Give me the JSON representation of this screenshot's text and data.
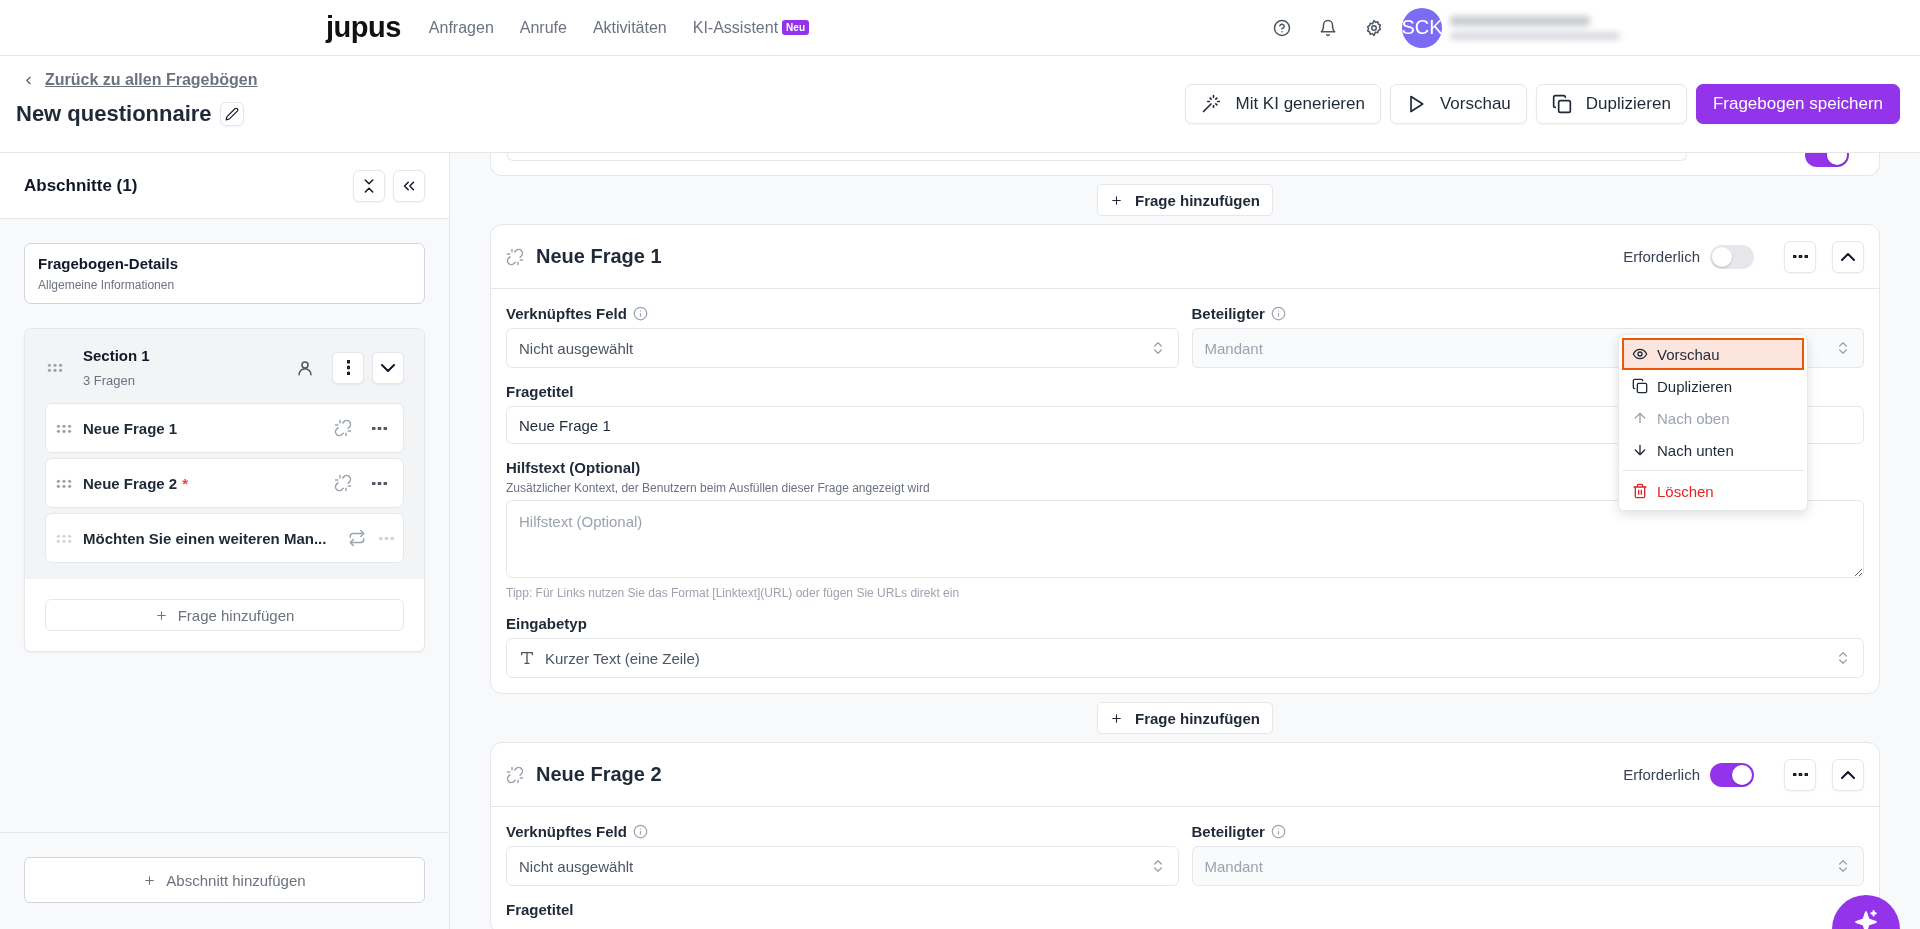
{
  "header": {
    "logo": "jupus",
    "nav": [
      {
        "label": "Anfragen"
      },
      {
        "label": "Anrufe"
      },
      {
        "label": "Aktivitäten"
      },
      {
        "label": "KI-Assistent",
        "badge": "Neu"
      }
    ],
    "avatar": "SCK"
  },
  "page": {
    "back_link": "Zurück zu allen Fragebögen",
    "title": "New questionnaire",
    "actions": [
      {
        "label": "Mit KI generieren",
        "kind": "wand"
      },
      {
        "label": "Vorschau",
        "kind": "play"
      },
      {
        "label": "Duplizieren",
        "kind": "copy"
      },
      {
        "label": "Fragebogen speichern",
        "kind": "primary"
      }
    ]
  },
  "sidebar": {
    "title": "Abschnitte (1)",
    "required_mark": "*",
    "details": {
      "title": "Fragebogen-Details",
      "subtitle": "Allgemeine Informationen"
    },
    "sections": [
      {
        "title": "Section 1",
        "count": "3 Fragen",
        "add_button": "Frage hinzufügen",
        "items": [
          {
            "label": "Neue Frage 1",
            "required": false,
            "kind": "unlinked",
            "disabled": false
          },
          {
            "label": "Neue Frage 2",
            "required": true,
            "kind": "unlinked",
            "disabled": false
          },
          {
            "label": "Möchten Sie einen weiteren Man...",
            "required": false,
            "kind": "repeat",
            "disabled": true
          }
        ]
      }
    ],
    "add_section": "Abschnitt hinzufügen"
  },
  "editor": {
    "partial_question": {
      "required": true
    },
    "questions": [
      {
        "add_button": "Frage hinzufügen",
        "title": "Neue Frage 1",
        "required_label": "Erforderlich",
        "required": false,
        "linked_field": {
          "label": "Verknüpftes Feld",
          "value": "Nicht ausgewählt"
        },
        "participant": {
          "label": "Beteiligter",
          "value": "Mandant",
          "disabled": true
        },
        "title_field": {
          "label": "Fragetitel",
          "value": "Neue Frage 1"
        },
        "help": {
          "label": "Hilfstext (Optional)",
          "description": "Zusätzlicher Kontext, der Benutzern beim Ausfüllen dieser Frage angezeigt wird",
          "placeholder": "Hilfstext (Optional)",
          "tip": "Tipp: Für Links nutzen Sie das Format [Linktext](URL) oder fügen Sie URLs direkt ein"
        },
        "input_type": {
          "label": "Eingabetyp",
          "value": "Kurzer Text (eine Zeile)"
        },
        "menu": {
          "groups": [
            [
              {
                "label": "Vorschau",
                "kind": "eye",
                "selected": true,
                "disabled": false
              },
              {
                "label": "Duplizieren",
                "kind": "copy",
                "selected": false,
                "disabled": false
              },
              {
                "label": "Nach oben",
                "kind": "up",
                "selected": false,
                "disabled": true
              },
              {
                "label": "Nach unten",
                "kind": "down",
                "selected": false,
                "disabled": false
              }
            ],
            [
              {
                "label": "Löschen",
                "kind": "trash",
                "selected": false,
                "disabled": false
              }
            ]
          ]
        }
      },
      {
        "add_button": "Frage hinzufügen",
        "title": "Neue Frage 2",
        "required_label": "Erforderlich",
        "required": true,
        "linked_field": {
          "label": "Verknüpftes Feld",
          "value": "Nicht ausgewählt"
        },
        "participant": {
          "label": "Beteiligter",
          "value": "Mandant",
          "disabled": true
        },
        "title_field": {
          "label": "Fragetitel"
        }
      }
    ]
  }
}
